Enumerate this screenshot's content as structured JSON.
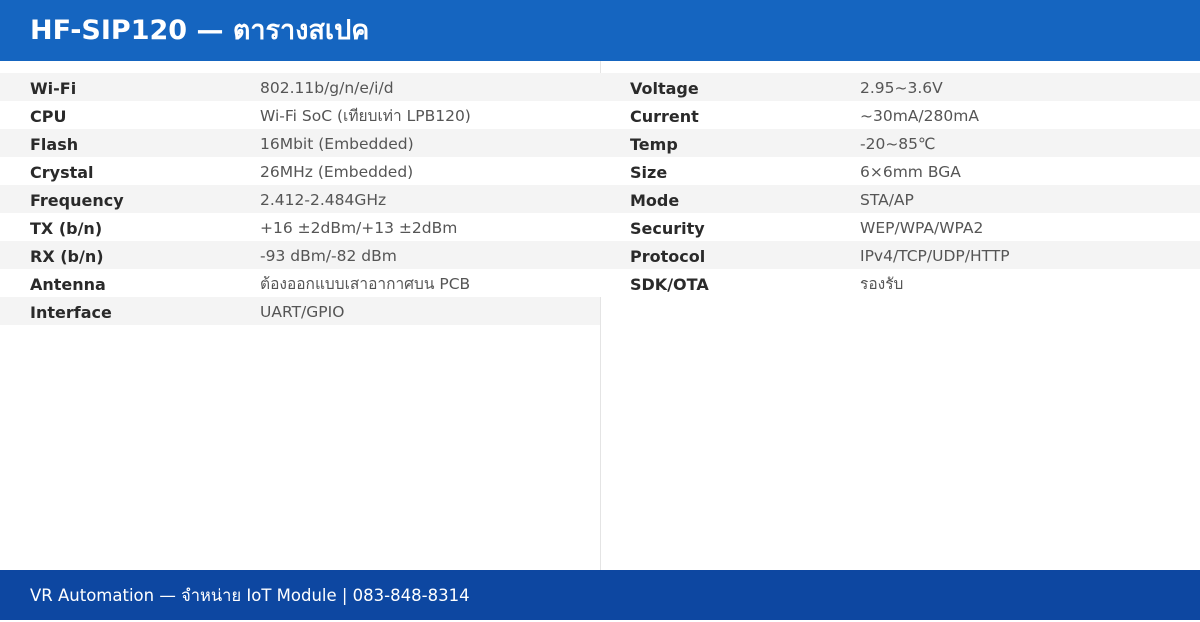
{
  "header": {
    "title": "HF-SIP120 — ตารางสเปค"
  },
  "specs": {
    "left": [
      {
        "label": "Wi-Fi",
        "value": "802.11b/g/n/e/i/d"
      },
      {
        "label": "CPU",
        "value": "Wi-Fi SoC (เทียบเท่า LPB120)"
      },
      {
        "label": "Flash",
        "value": "16Mbit (Embedded)"
      },
      {
        "label": "Crystal",
        "value": "26MHz (Embedded)"
      },
      {
        "label": "Frequency",
        "value": "2.412-2.484GHz"
      },
      {
        "label": "TX (b/n)",
        "value": "+16 ±2dBm/+13 ±2dBm"
      },
      {
        "label": "RX (b/n)",
        "value": "-93 dBm/-82 dBm"
      },
      {
        "label": "Antenna",
        "value": "ต้องออกแบบเสาอากาศบน PCB"
      },
      {
        "label": "Interface",
        "value": "UART/GPIO"
      }
    ],
    "right": [
      {
        "label": "Voltage",
        "value": "2.95~3.6V"
      },
      {
        "label": "Current",
        "value": "~30mA/280mA"
      },
      {
        "label": "Temp",
        "value": "-20~85℃"
      },
      {
        "label": "Size",
        "value": "6×6mm BGA"
      },
      {
        "label": "Mode",
        "value": "STA/AP"
      },
      {
        "label": "Security",
        "value": "WEP/WPA/WPA2"
      },
      {
        "label": "Protocol",
        "value": "IPv4/TCP/UDP/HTTP"
      },
      {
        "label": "SDK/OTA",
        "value": "รองรับ"
      }
    ]
  },
  "footer": {
    "text": "VR Automation — จำหน่าย IoT Module | 083-848-8314"
  },
  "colors": {
    "header_bg": "#1565c0",
    "footer_bg": "#0d47a1",
    "row_alt_bg": "#f4f4f4"
  }
}
